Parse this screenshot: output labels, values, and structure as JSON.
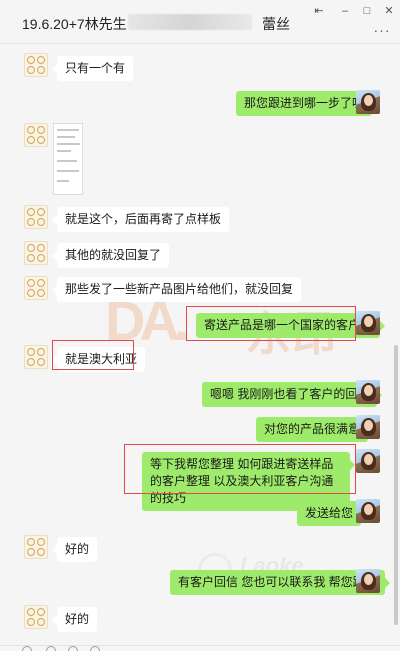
{
  "window": {
    "title_prefix": "19.6.20+7林先生",
    "title_suffix": "蕾丝",
    "buttons": {
      "pin": "⇤",
      "minimize": "–",
      "maximize": "□",
      "close": "✕"
    },
    "more": "···"
  },
  "messages": [
    {
      "side": "left",
      "text": "只有一个有"
    },
    {
      "side": "right",
      "text": "那您跟进到哪一步了呢"
    },
    {
      "side": "left",
      "type": "image"
    },
    {
      "side": "left",
      "text": "就是这个，后面再寄了点样板"
    },
    {
      "side": "left",
      "text": "其他的就没回复了"
    },
    {
      "side": "left",
      "text": "那些发了一些新产品图片给他们，就没回复"
    },
    {
      "side": "right",
      "text": "寄送产品是哪一个国家的客户呀"
    },
    {
      "side": "left",
      "text": "就是澳大利亚"
    },
    {
      "side": "right",
      "text": "嗯嗯 我刚刚也看了客户的回复"
    },
    {
      "side": "right",
      "text": "对您的产品很满意"
    },
    {
      "side": "right",
      "text": "等下我帮您整理 如何跟进寄送样品的客户整理 以及澳大利亚客户沟通的技巧"
    },
    {
      "side": "right",
      "text": "发送给您"
    },
    {
      "side": "left",
      "text": "好的"
    },
    {
      "side": "right",
      "text": "有客户回信 您也可以联系我 帮您跟进"
    },
    {
      "side": "left",
      "text": "好的"
    }
  ],
  "watermarks": {
    "big_latin": "DA.",
    "big_cn": "东昂",
    "small": "Laoke",
    "small_sub": "LAOKE.COM"
  },
  "colors": {
    "bubble_self": "#9eea6a",
    "bubble_other": "#ffffff",
    "highlight_box": "#e04a4a"
  }
}
